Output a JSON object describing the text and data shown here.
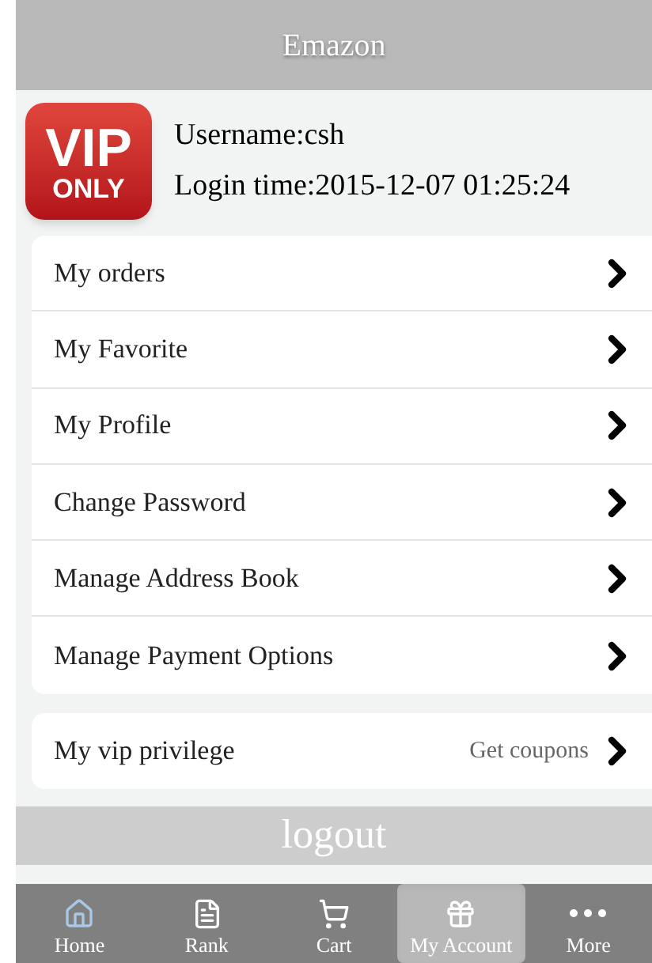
{
  "header": {
    "title": "Emazon"
  },
  "profile": {
    "badge": {
      "line_1": "VIP",
      "line_2": "ONLY"
    },
    "username": "Username:csh",
    "login_time": "Login time:2015-12-07 01:25:24"
  },
  "menu": [
    {
      "label": "My orders"
    },
    {
      "label": "My Favorite"
    },
    {
      "label": "My Profile"
    },
    {
      "label": "Change Password"
    },
    {
      "label": "Manage Address Book"
    },
    {
      "label": "Manage Payment Options"
    }
  ],
  "vip": {
    "label": "My vip privilege",
    "action": "Get coupons"
  },
  "logout": {
    "label": "logout"
  },
  "tab_bar": [
    {
      "kind": "home",
      "label": "Home",
      "selected": false
    },
    {
      "kind": "rank",
      "label": "Rank",
      "selected": false
    },
    {
      "kind": "cart",
      "label": "Cart",
      "selected": false
    },
    {
      "kind": "account",
      "label": "My Account",
      "selected": true
    },
    {
      "kind": "more",
      "label": "More",
      "selected": false
    }
  ]
}
